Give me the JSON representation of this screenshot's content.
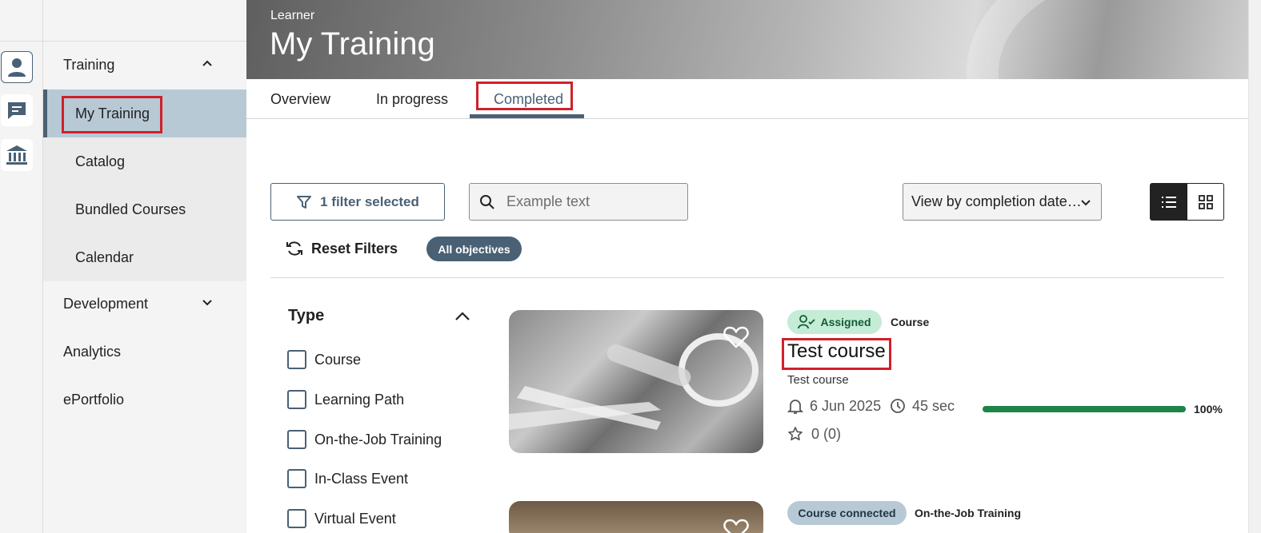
{
  "banner": {
    "subtitle": "Learner",
    "title": "My Training"
  },
  "sidebar": {
    "groups": [
      {
        "label": "Training",
        "expanded": true
      },
      {
        "label": "Development",
        "expanded": false
      },
      {
        "label": "Analytics"
      },
      {
        "label": "ePortfolio"
      }
    ],
    "training_items": [
      {
        "label": "My Training",
        "active": true
      },
      {
        "label": "Catalog"
      },
      {
        "label": "Bundled Courses"
      },
      {
        "label": "Calendar"
      }
    ]
  },
  "rail": {
    "icons": [
      "person-icon",
      "chat-icon",
      "institution-icon"
    ]
  },
  "tabs": [
    {
      "label": "Overview"
    },
    {
      "label": "In progress"
    },
    {
      "label": "Completed",
      "active": true
    }
  ],
  "toolbar": {
    "filter_label": "1 filter selected",
    "search_placeholder": "Example text",
    "sort_label": "View by completion date…",
    "reset_label": "Reset Filters",
    "objectives_chip": "All objectives"
  },
  "type_filter": {
    "title": "Type",
    "options": [
      "Course",
      "Learning Path",
      "On-the-Job Training",
      "In-Class Event",
      "Virtual Event"
    ]
  },
  "courses": [
    {
      "badge": "Assigned",
      "type": "Course",
      "title": "Test course",
      "subtitle": "Test course",
      "date": "6 Jun 2025",
      "duration": "45 sec",
      "progress": 100,
      "progress_label": "100%",
      "rating": "0 (0)"
    },
    {
      "badge": "Course connected",
      "type": "On-the-Job Training"
    }
  ],
  "colors": {
    "accent": "#4a6175",
    "active_nav": "#b8c9d6",
    "assigned_badge": "#c4ecd6",
    "progress": "#1e8449",
    "highlight": "#d0202a"
  }
}
